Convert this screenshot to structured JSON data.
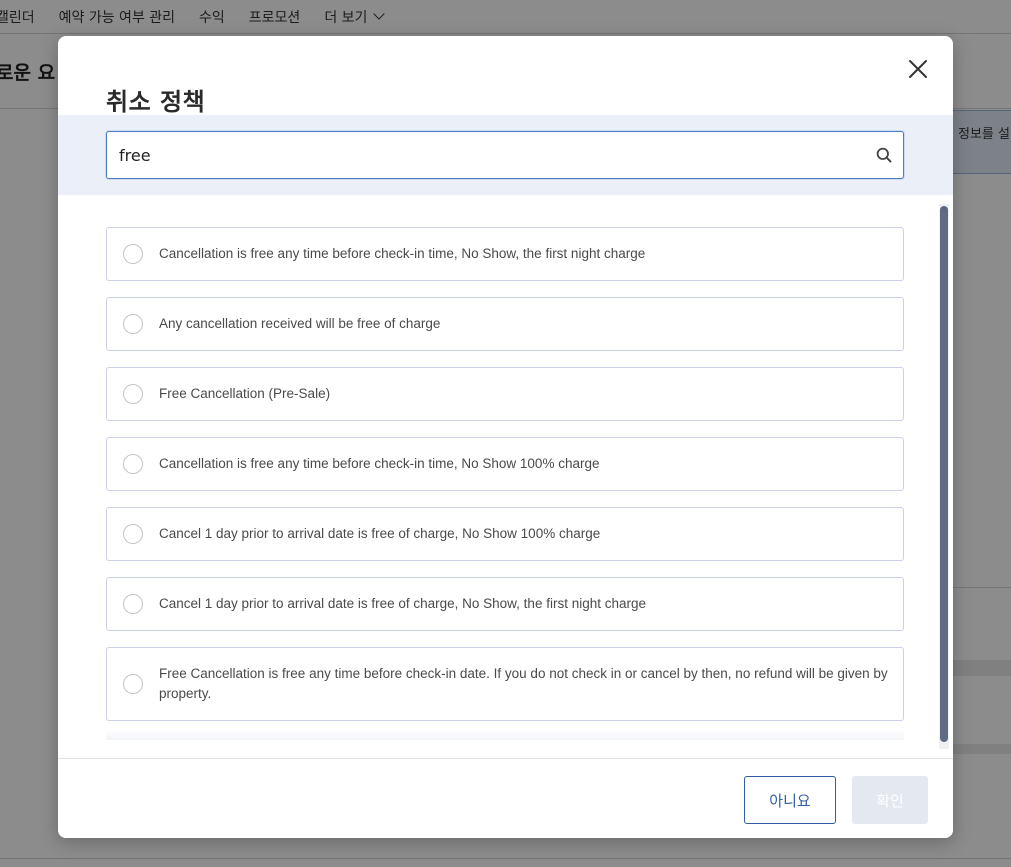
{
  "background": {
    "nav_items": [
      "캘린더",
      "예약 가능 여부 관리",
      "수익",
      "프로모션",
      "더 보기"
    ],
    "page_title": "로운 요",
    "info_text": "정보를 설정"
  },
  "modal": {
    "title": "취소 정책",
    "search": {
      "value": "free",
      "placeholder": ""
    },
    "options": [
      {
        "label": "Cancellation is free any time before check-in time, No Show, the first night charge",
        "selected": false
      },
      {
        "label": "Any cancellation received will be free of charge",
        "selected": false
      },
      {
        "label": "Free Cancellation (Pre-Sale)",
        "selected": false
      },
      {
        "label": "Cancellation is free any time before check-in time, No Show 100% charge",
        "selected": false
      },
      {
        "label": "Cancel 1 day prior to arrival date is free of charge, No Show 100% charge",
        "selected": false
      },
      {
        "label": "Cancel 1 day prior to arrival date is free of charge, No Show, the first night charge",
        "selected": false
      },
      {
        "label": "Free Cancellation is free any time before check-in date. If you do not check in or cancel by then, no refund will be given by property.",
        "selected": false
      }
    ],
    "buttons": {
      "no": "아니요",
      "ok": "확인"
    }
  },
  "colors": {
    "accent": "#2f5da8",
    "search_band": "#ebeff8",
    "scrollbar": "#5f6b84",
    "ok_disabled": "#e4e8ef"
  },
  "icons": {
    "close": "close-icon",
    "search": "search-icon",
    "more": "chevron-down-icon"
  }
}
